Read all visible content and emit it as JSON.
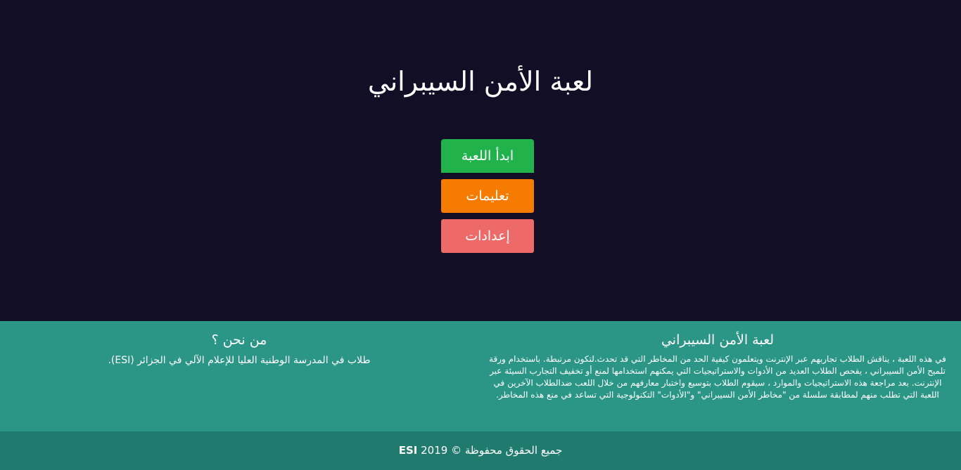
{
  "hero": {
    "title": "لعبة  الأمن السيبراني"
  },
  "menu": {
    "start_label": "ابدأ اللعبة",
    "instructions_label": "تعليمات",
    "settings_label": "إعدادات"
  },
  "about_game": {
    "heading": "لعبة  الأمن السيبراني",
    "description": "في هذه اللعبة ، يناقش الطلاب تجاربهم عبر الإنترنت ويتعلمون كيفية الحد من المخاطر التي قد تحدث.لتكون مرتبطة. باستخدام ورقة تلميح الأمن السيبراني ، يفحص الطلاب العديد من الأدوات والاستراتيجيات التي يمكنهم استخدامها لمنع أو تخفيف التجارب السيئة عبر الإنترنت. بعد مراجعة هذه الاستراتيجيات والموارد ، سيقوم الطلاب بتوسيع واختبار معارفهم من خلال اللعب ضدالطلاب الآخرين في اللعبة التي تطلب منهم لمطابقة سلسلة من \"مخاطر الأمن السيبراني\" و\"الأدوات\" التكنولوجية التي تساعد في منع هذه المخاطر."
  },
  "about_us": {
    "heading": "من نحن ؟",
    "description": "طلاب في المدرسة الوطنية العليا للإعلام الآلي في الجزائر (ESI)."
  },
  "footer": {
    "rights_text": "جميع الحقوق محفوظة © 2019",
    "brand": "ESI"
  },
  "colors": {
    "background": "#110e26",
    "start_button": "#21b24b",
    "instructions_button": "#f57c00",
    "settings_button": "#ee6a69",
    "info_section": "#2b9686",
    "footer": "#207a6d"
  }
}
